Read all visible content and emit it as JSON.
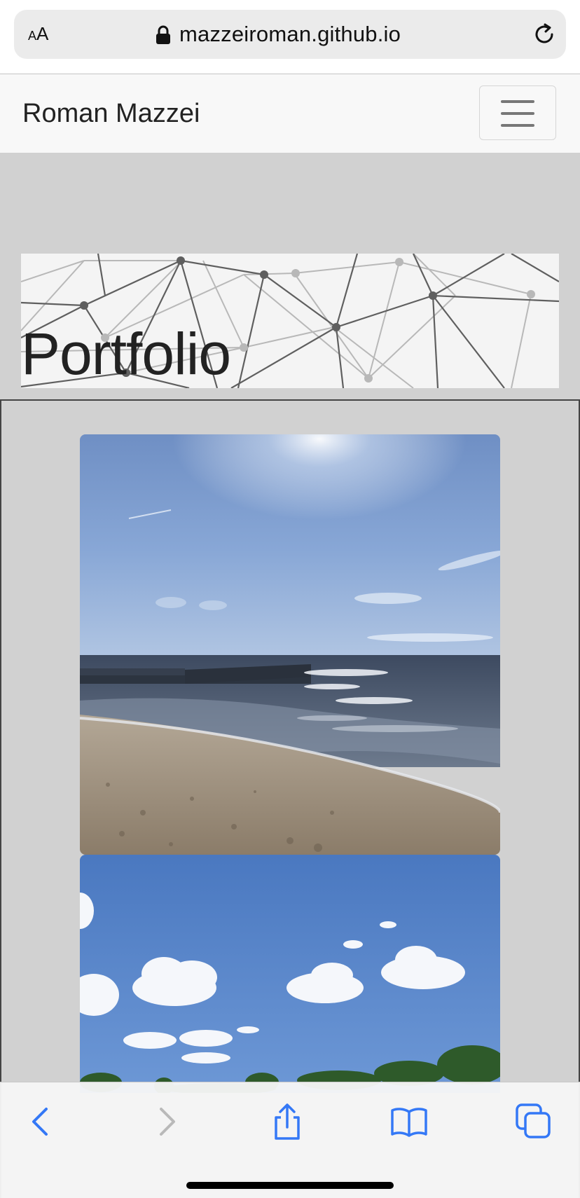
{
  "browser": {
    "reader_label_small": "A",
    "reader_label_large": "A",
    "url": "mazzeiroman.github.io",
    "icons": {
      "lock": "lock-icon",
      "reload": "reload-icon",
      "back": "chevron-left-icon",
      "forward": "chevron-right-icon",
      "share": "share-icon",
      "bookmarks": "book-icon",
      "tabs": "tabs-icon"
    },
    "accent_color": "#3478f6"
  },
  "navbar": {
    "brand": "Roman Mazzei",
    "toggler_icon": "hamburger-icon"
  },
  "hero": {
    "title": "Portfolio"
  },
  "gallery": {
    "photos": [
      {
        "subject": "beach-photo"
      },
      {
        "subject": "sky-clouds-photo"
      }
    ]
  }
}
